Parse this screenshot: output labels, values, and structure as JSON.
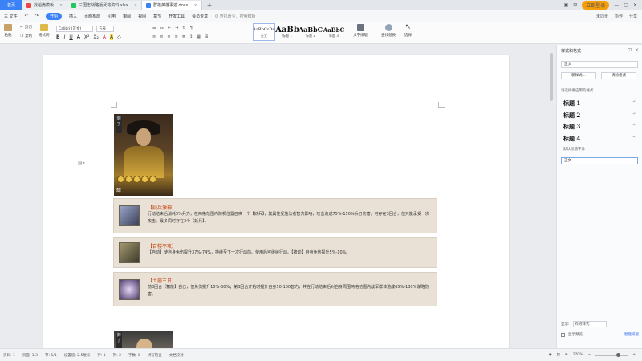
{
  "tabs": {
    "home": "首页",
    "items": [
      {
        "label": "找稻壳模板",
        "color": "#ef4444",
        "active": false
      },
      {
        "label": "三国志战略版武将资料.xlsx",
        "color": "#22c55e",
        "active": false
      },
      {
        "label": "群雄英雄事迹.docx",
        "color": "#3b82f6",
        "active": true
      }
    ],
    "plus": "+",
    "login": "立即登录"
  },
  "menu": {
    "file": "三 文件",
    "start": "开始",
    "items": [
      "插入",
      "页面布局",
      "引用",
      "审阅",
      "视图",
      "章节",
      "开发工具",
      "会员专享"
    ],
    "search": "Q 查找命令、搜索模板",
    "right": [
      "未同步",
      "协作",
      "分享"
    ]
  },
  "ribbon": {
    "paste": "粘贴",
    "cut": "剪切",
    "copy": "复制",
    "format_painter": "格式刷",
    "font": "Calibri (正文)",
    "size": "五号",
    "bold": "B",
    "italic": "I",
    "underline": "U",
    "styles": [
      {
        "sample": "AaBbCcDd",
        "name": "正文"
      },
      {
        "sample": "AaBb",
        "name": "标题 1"
      },
      {
        "sample": "AaBbC",
        "name": "标题 2"
      },
      {
        "sample": "AaBbC",
        "name": "标题 3"
      }
    ],
    "text_tools": "文字排版",
    "find_replace": "查找替换",
    "select": "选择"
  },
  "document": {
    "hero_tag": "御了",
    "cost": "肆",
    "skills": [
      {
        "title": "【疑兵激神】",
        "desc": "行动结束后消耗5%兵力，在两格范围内随机位置召唤一个【妖兵】，其属性受施法者智力影响，攻击造成75%-150%兵刃伤害，可存在3回合，但只能承受一次攻击。最多同时存在3个【妖兵】。"
      },
      {
        "title": "【百楼不攻】",
        "desc": "【自动】使自身免伤提升37%-74%，持续至下一次行动前。使用后可继续行动。【被动】自身免伤提升5%-10%。"
      },
      {
        "title": "【土崩三日】",
        "desc": "前3回合【蓄能】自己，但免伤提升15%-30%；第3回合开始时提升自身50-100智力，并在行动结束后对自身周围两格范围内敌军群体造成65%-130%谋略伤害。"
      }
    ],
    "hero2_tag": "御了"
  },
  "panel": {
    "title": "样式和格式",
    "current_style": "正文",
    "new_style": "新样式...",
    "clear_format": "清除格式",
    "apply_label": "请选择要应用的格式",
    "styles": [
      "标题 1",
      "标题 2",
      "标题 3",
      "标题 4"
    ],
    "default_font": "默认段落字体",
    "normal": "正文",
    "show_label": "显示:",
    "show_value": "有效样式",
    "preview_label": "显示预览",
    "smart_format": "智能排版"
  },
  "status": {
    "page": "页码: 1",
    "pages": "页面: 1/3",
    "section": "节: 1/1",
    "position": "设置值: 2.5厘米",
    "row": "行: 1",
    "col": "列: 2",
    "words": "字数: 0",
    "spell": "拼写检查",
    "proof": "文档校对",
    "zoom": "170%",
    "zoom_minus": "−",
    "zoom_plus": "+"
  }
}
